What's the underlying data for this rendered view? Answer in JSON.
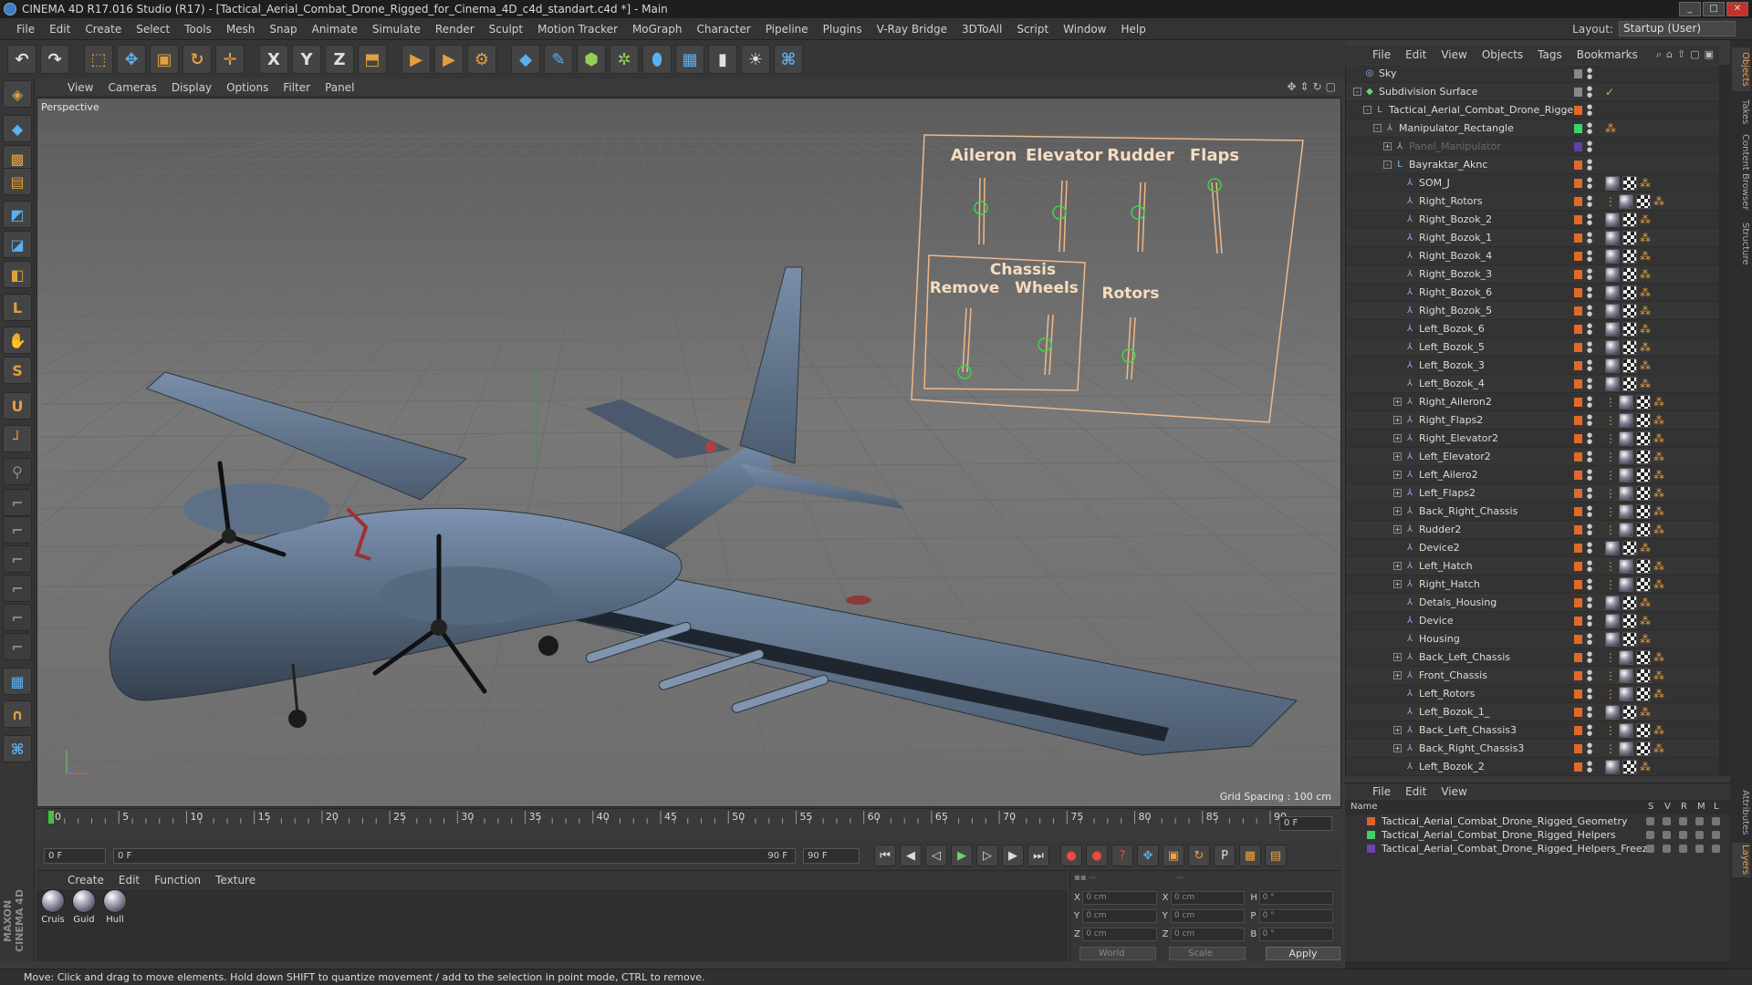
{
  "title": "CINEMA 4D R17.016 Studio (R17) - [Tactical_Aerial_Combat_Drone_Rigged_for_Cinema_4D_c4d_standart.c4d *] - Main",
  "menu": [
    "File",
    "Edit",
    "Create",
    "Select",
    "Tools",
    "Mesh",
    "Snap",
    "Animate",
    "Simulate",
    "Render",
    "Sculpt",
    "Motion Tracker",
    "MoGraph",
    "Character",
    "Pipeline",
    "Plugins",
    "V-Ray Bridge",
    "3DToAll",
    "Script",
    "Window",
    "Help"
  ],
  "layout": {
    "label": "Layout:",
    "value": "Startup (User)"
  },
  "toolbar": {
    "buttons": [
      {
        "name": "undo-icon",
        "glyph": "↶"
      },
      {
        "name": "redo-icon",
        "glyph": "↷"
      },
      {
        "name": "live-selection-icon",
        "glyph": "⬚"
      },
      {
        "name": "move-icon",
        "glyph": "✥"
      },
      {
        "name": "scale-icon",
        "glyph": "▣"
      },
      {
        "name": "rotate-icon",
        "glyph": "↻"
      },
      {
        "name": "move-active-icon",
        "glyph": "✛"
      },
      {
        "name": "x-axis-icon",
        "glyph": "X"
      },
      {
        "name": "y-axis-icon",
        "glyph": "Y"
      },
      {
        "name": "z-axis-icon",
        "glyph": "Z"
      },
      {
        "name": "coord-system-icon",
        "glyph": "⬒"
      },
      {
        "name": "render-view-icon",
        "glyph": "▶"
      },
      {
        "name": "render-picture-viewer-icon",
        "glyph": "▶"
      },
      {
        "name": "render-settings-icon",
        "glyph": "⚙"
      },
      {
        "name": "cube-icon",
        "glyph": "◆"
      },
      {
        "name": "pen-icon",
        "glyph": "✎"
      },
      {
        "name": "subdivision-icon",
        "glyph": "⬢"
      },
      {
        "name": "array-icon",
        "glyph": "✲"
      },
      {
        "name": "deformer-icon",
        "glyph": "⬮"
      },
      {
        "name": "floor-icon",
        "glyph": "▦"
      },
      {
        "name": "camera-icon",
        "glyph": "▮"
      },
      {
        "name": "light-icon",
        "glyph": "☀"
      },
      {
        "name": "python-icon",
        "glyph": "⌘"
      }
    ]
  },
  "viewport": {
    "menu": [
      "View",
      "Cameras",
      "Display",
      "Options",
      "Filter",
      "Panel"
    ],
    "label": "Perspective",
    "grid_spacing": "Grid Spacing : 100 cm",
    "panel": {
      "top_labels": [
        "Aileron",
        "Elevator",
        "Rudder",
        "Flaps"
      ],
      "group_label": "Chassis",
      "bottom_labels": [
        "Remove",
        "Wheels",
        "Rotors"
      ]
    }
  },
  "timeline": {
    "ticks": [
      "0",
      "5",
      "10",
      "15",
      "20",
      "25",
      "30",
      "35",
      "40",
      "45",
      "50",
      "55",
      "60",
      "65",
      "70",
      "75",
      "80",
      "85",
      "90"
    ],
    "current_frame": "0 F"
  },
  "transport": {
    "start_field": "0 F",
    "range_start": "0 F",
    "range_end": "90 F",
    "end_field": "90 F"
  },
  "material_manager": {
    "menu": [
      "Create",
      "Edit",
      "Function",
      "Texture"
    ],
    "materials": [
      "Cruis",
      "Guid",
      "Hull"
    ]
  },
  "coordinates": {
    "rows": [
      {
        "a": "X",
        "av": "0 cm",
        "b": "X",
        "bv": "0 cm",
        "c": "H",
        "cv": "0 °"
      },
      {
        "a": "Y",
        "av": "0 cm",
        "b": "Y",
        "bv": "0 cm",
        "c": "P",
        "cv": "0 °"
      },
      {
        "a": "Z",
        "av": "0 cm",
        "b": "Z",
        "bv": "0 cm",
        "c": "B",
        "cv": "0 °"
      }
    ],
    "mode": "World",
    "scale": "Scale",
    "apply": "Apply"
  },
  "status": "Move: Click and drag to move elements. Hold down SHIFT to quantize movement / add to the selection in point mode, CTRL to remove.",
  "object_manager": {
    "menu": [
      "File",
      "Edit",
      "View",
      "Objects",
      "Tags",
      "Bookmarks"
    ],
    "rows": [
      {
        "name": "Sky",
        "depth": 0,
        "exp": "",
        "color": "#888",
        "icon": "sky"
      },
      {
        "name": "Subdivision Surface",
        "depth": 0,
        "exp": "-",
        "color": "#888",
        "icon": "subd",
        "tick": true
      },
      {
        "name": "Tactical_Aerial_Combat_Drone_Rigged",
        "depth": 1,
        "exp": "-",
        "color": "#e06a2a",
        "icon": "null"
      },
      {
        "name": "Manipulator_Rectangle",
        "depth": 2,
        "exp": "-",
        "color": "#38d66a",
        "icon": "bone",
        "ik": true
      },
      {
        "name": "Panel_Manipulator",
        "depth": 3,
        "exp": "+",
        "color": "#6040a0",
        "icon": "bone",
        "dim": true
      },
      {
        "name": "Bayraktar_Aknc",
        "depth": 3,
        "exp": "-",
        "color": "#e06a2a",
        "icon": "null"
      },
      {
        "name": "SOM_J",
        "depth": 4,
        "exp": "",
        "color": "#e06a2a",
        "icon": "bone",
        "tags": 3
      },
      {
        "name": "Right_Rotors",
        "depth": 4,
        "exp": "",
        "color": "#e06a2a",
        "icon": "bone",
        "tags": 4
      },
      {
        "name": "Right_Bozok_2",
        "depth": 4,
        "exp": "",
        "color": "#e06a2a",
        "icon": "bone",
        "tags": 3
      },
      {
        "name": "Right_Bozok_1",
        "depth": 4,
        "exp": "",
        "color": "#e06a2a",
        "icon": "bone",
        "tags": 3
      },
      {
        "name": "Right_Bozok_4",
        "depth": 4,
        "exp": "",
        "color": "#e06a2a",
        "icon": "bone",
        "tags": 3
      },
      {
        "name": "Right_Bozok_3",
        "depth": 4,
        "exp": "",
        "color": "#e06a2a",
        "icon": "bone",
        "tags": 3
      },
      {
        "name": "Right_Bozok_6",
        "depth": 4,
        "exp": "",
        "color": "#e06a2a",
        "icon": "bone",
        "tags": 3
      },
      {
        "name": "Right_Bozok_5",
        "depth": 4,
        "exp": "",
        "color": "#e06a2a",
        "icon": "bone",
        "tags": 3
      },
      {
        "name": "Left_Bozok_6",
        "depth": 4,
        "exp": "",
        "color": "#e06a2a",
        "icon": "bone",
        "tags": 3
      },
      {
        "name": "Left_Bozok_5",
        "depth": 4,
        "exp": "",
        "color": "#e06a2a",
        "icon": "bone",
        "tags": 3
      },
      {
        "name": "Left_Bozok_3",
        "depth": 4,
        "exp": "",
        "color": "#e06a2a",
        "icon": "bone",
        "tags": 3
      },
      {
        "name": "Left_Bozok_4",
        "depth": 4,
        "exp": "",
        "color": "#e06a2a",
        "icon": "bone",
        "tags": 3
      },
      {
        "name": "Right_Aileron2",
        "depth": 4,
        "exp": "+",
        "color": "#e06a2a",
        "icon": "bone",
        "tags": 4
      },
      {
        "name": "Right_Flaps2",
        "depth": 4,
        "exp": "+",
        "color": "#e06a2a",
        "icon": "bone",
        "tags": 4
      },
      {
        "name": "Right_Elevator2",
        "depth": 4,
        "exp": "+",
        "color": "#e06a2a",
        "icon": "bone",
        "tags": 4
      },
      {
        "name": "Left_Elevator2",
        "depth": 4,
        "exp": "+",
        "color": "#e06a2a",
        "icon": "bone",
        "tags": 4
      },
      {
        "name": "Left_Ailero2",
        "depth": 4,
        "exp": "+",
        "color": "#e06a2a",
        "icon": "bone",
        "tags": 4
      },
      {
        "name": "Left_Flaps2",
        "depth": 4,
        "exp": "+",
        "color": "#e06a2a",
        "icon": "bone",
        "tags": 4
      },
      {
        "name": "Back_Right_Chassis",
        "depth": 4,
        "exp": "+",
        "color": "#e06a2a",
        "icon": "bone",
        "tags": 4
      },
      {
        "name": "Rudder2",
        "depth": 4,
        "exp": "+",
        "color": "#e06a2a",
        "icon": "bone",
        "tags": 4
      },
      {
        "name": "Device2",
        "depth": 4,
        "exp": "",
        "color": "#e06a2a",
        "icon": "bone",
        "tags": 3
      },
      {
        "name": "Left_Hatch",
        "depth": 4,
        "exp": "+",
        "color": "#e06a2a",
        "icon": "bone",
        "tags": 4
      },
      {
        "name": "Right_Hatch",
        "depth": 4,
        "exp": "+",
        "color": "#e06a2a",
        "icon": "bone",
        "tags": 4
      },
      {
        "name": "Detals_Housing",
        "depth": 4,
        "exp": "",
        "color": "#e06a2a",
        "icon": "bone",
        "tags": 3
      },
      {
        "name": "Device",
        "depth": 4,
        "exp": "",
        "color": "#e06a2a",
        "icon": "bone",
        "tags": 3
      },
      {
        "name": "Housing",
        "depth": 4,
        "exp": "",
        "color": "#e06a2a",
        "icon": "bone",
        "tags": 3
      },
      {
        "name": "Back_Left_Chassis",
        "depth": 4,
        "exp": "+",
        "color": "#e06a2a",
        "icon": "bone",
        "tags": 4
      },
      {
        "name": "Front_Chassis",
        "depth": 4,
        "exp": "+",
        "color": "#e06a2a",
        "icon": "bone",
        "tags": 4
      },
      {
        "name": "Left_Rotors",
        "depth": 4,
        "exp": "",
        "color": "#e06a2a",
        "icon": "bone",
        "tags": 4
      },
      {
        "name": "Left_Bozok_1_",
        "depth": 4,
        "exp": "",
        "color": "#e06a2a",
        "icon": "bone",
        "tags": 3
      },
      {
        "name": "Back_Left_Chassis3",
        "depth": 4,
        "exp": "+",
        "color": "#e06a2a",
        "icon": "bone",
        "tags": 4
      },
      {
        "name": "Back_Right_Chassis3",
        "depth": 4,
        "exp": "+",
        "color": "#e06a2a",
        "icon": "bone",
        "tags": 4
      },
      {
        "name": "Left_Bozok_2",
        "depth": 4,
        "exp": "",
        "color": "#e06a2a",
        "icon": "bone",
        "tags": 3
      }
    ]
  },
  "side_tabs": [
    "Objects",
    "Takes",
    "Content Browser",
    "Structure"
  ],
  "side_tabs_lower": [
    "Attributes",
    "Layers"
  ],
  "layer_manager": {
    "menu": [
      "File",
      "Edit",
      "View"
    ],
    "headers": {
      "name": "Name",
      "s": "S",
      "v": "V",
      "r": "R",
      "m": "M",
      "l": "L"
    },
    "layers": [
      {
        "name": "Tactical_Aerial_Combat_Drone_Rigged_Geometry",
        "color": "#e0602a"
      },
      {
        "name": "Tactical_Aerial_Combat_Drone_Rigged_Helpers",
        "color": "#38d66a"
      },
      {
        "name": "Tactical_Aerial_Combat_Drone_Rigged_Helpers_Freeze",
        "color": "#7040b0"
      }
    ]
  }
}
